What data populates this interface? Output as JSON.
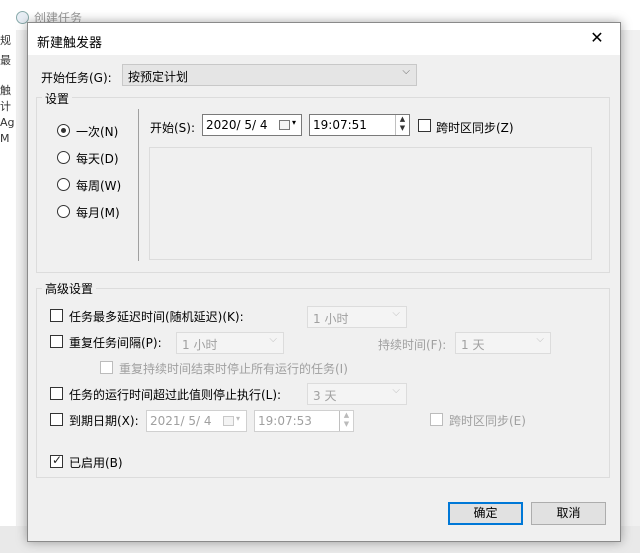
{
  "background": {
    "window_title": "创建任务",
    "left_glyphs": [
      "↓",
      "规",
      "最",
      "触",
      "计",
      "Ag",
      "M"
    ]
  },
  "dialog": {
    "title": "新建触发器",
    "close_glyph": "✕",
    "begin_task": {
      "label": "开始任务(G):",
      "value": "按预定计划"
    },
    "settings": {
      "group_label": "设置",
      "schedule_options": [
        {
          "label": "一次(N)",
          "checked": true
        },
        {
          "label": "每天(D)",
          "checked": false
        },
        {
          "label": "每周(W)",
          "checked": false
        },
        {
          "label": "每月(M)",
          "checked": false
        }
      ],
      "start_label": "开始(S):",
      "start_date": "2020/  5/  4",
      "start_time": "19:07:51",
      "sync_timezone_label": "跨时区同步(Z)"
    },
    "advanced": {
      "group_label": "高级设置",
      "delay_label": "任务最多延迟时间(随机延迟)(K):",
      "delay_value": "1 小时",
      "repeat_label": "重复任务间隔(P):",
      "repeat_value": "1 小时",
      "duration_label": "持续时间(F):",
      "duration_value": "1 天",
      "stop_repeat_label": "重复持续时间结束时停止所有运行的任务(I)",
      "stop_if_runs_label": "任务的运行时间超过此值则停止执行(L):",
      "stop_if_runs_value": "3 天",
      "expire_label": "到期日期(X):",
      "expire_date": "2021/  5/  4",
      "expire_time": "19:07:53",
      "expire_sync_label": "跨时区同步(E)",
      "enabled_label": "已启用(B)",
      "enabled_checked": true
    },
    "ok_label": "确定",
    "cancel_label": "取消"
  }
}
